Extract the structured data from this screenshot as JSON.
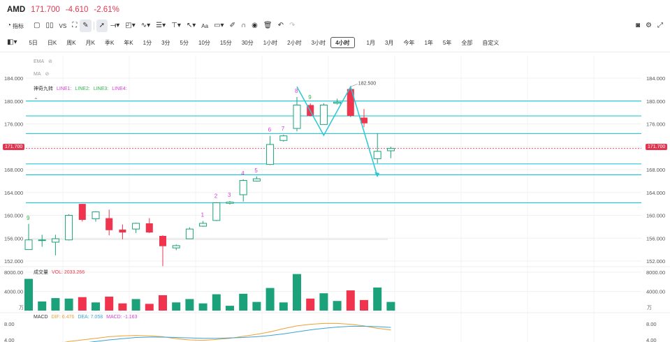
{
  "header": {
    "symbol": "AMD",
    "price": "171.700",
    "change": "-4.610",
    "change_pct": "-2.61%",
    "neg_color": "#e0364f"
  },
  "toolbar": {
    "indicators_label": "指标",
    "vs_label": "VS",
    "text_tool_label": "Aa",
    "icons": [
      "indicators-icon",
      "square-icon",
      "pair-icon",
      "vs-icon",
      "compare-icon",
      "brush-icon",
      "cursor-icon",
      "line-tool-icon",
      "rect-tool-icon",
      "wave-tool-icon",
      "fib-tool-icon",
      "measure-tool-icon",
      "arrow-tool-icon",
      "text-tool-icon",
      "comment-icon",
      "pen-icon",
      "magnet-icon",
      "eye-icon",
      "trash-icon",
      "undo-icon",
      "redo-icon",
      "camera-icon",
      "settings-icon",
      "fullscreen-icon"
    ]
  },
  "periods": {
    "layout_icon": "layout-icon",
    "items": [
      "5日",
      "日K",
      "周K",
      "月K",
      "季K",
      "年K",
      "1分",
      "3分",
      "5分",
      "10分",
      "15分",
      "30分",
      "1小时",
      "2小时",
      "3小时",
      "4小时",
      "1月",
      "3月",
      "今年",
      "1年",
      "5年",
      "全部",
      "自定义"
    ],
    "active": "4小时"
  },
  "main_chart": {
    "ema_label": "EMA",
    "ma_label": "MA",
    "td_label": "神奇九转",
    "lines": [
      {
        "name": "LINE1:",
        "color": "#d63cd6"
      },
      {
        "name": "LINE2:",
        "color": "#2fb54a"
      },
      {
        "name": "LINE3:",
        "color": "#2fb54a"
      },
      {
        "name": "LINE4:",
        "color": "#d63cd6"
      }
    ],
    "current_price_tag": "171.700",
    "peak_label": "182.500",
    "up_color": "#1ba27a",
    "down_color": "#f0344d",
    "support_color": "#29c7d6"
  },
  "volume": {
    "title": "成交量",
    "vol_label": "VOL: 2033.266",
    "unit": "万"
  },
  "macd": {
    "title": "MACD",
    "dif": "DIF: 6.476",
    "dea": "DEA: 7.058",
    "macd": "MACD: -1.163",
    "dif_color": "#f0a030",
    "dea_color": "#3aa3d9",
    "macd_color": "#d63cd6"
  },
  "chart_data": {
    "type": "candlestick",
    "price_axis_ticks": [
      "184.000",
      "180.000",
      "176.000",
      "172.000",
      "168.000",
      "164.000",
      "160.000",
      "156.000",
      "152.000"
    ],
    "volume_axis_ticks": [
      "8000.00",
      "4000.00"
    ],
    "macd_axis_ticks": [
      "8.00",
      "4.00"
    ],
    "support_lines": [
      180.0,
      177.4,
      174.3,
      169.0,
      167.1,
      162.2
    ],
    "candles": [
      {
        "o": 154.0,
        "c": 155.7,
        "h": 158.5,
        "l": 154.0,
        "td": "9",
        "td_color": "#2fb54a"
      },
      {
        "o": 155.6,
        "c": 155.7,
        "h": 156.6,
        "l": 154.5
      },
      {
        "o": 155.3,
        "c": 155.9,
        "h": 156.6,
        "l": 153.0
      },
      {
        "o": 155.7,
        "c": 160.0,
        "h": 160.2,
        "l": 155.6
      },
      {
        "o": 162.0,
        "c": 159.2,
        "h": 162.0,
        "l": 158.9
      },
      {
        "o": 159.4,
        "c": 160.6,
        "h": 160.7,
        "l": 158.9
      },
      {
        "o": 159.5,
        "c": 157.4,
        "h": 161.0,
        "l": 156.5
      },
      {
        "o": 157.5,
        "c": 157.0,
        "h": 158.4,
        "l": 155.8
      },
      {
        "o": 157.6,
        "c": 158.6,
        "h": 158.7,
        "l": 156.9
      },
      {
        "o": 158.6,
        "c": 157.0,
        "h": 159.5,
        "l": 156.9
      },
      {
        "o": 156.4,
        "c": 154.6,
        "h": 156.5,
        "l": 151.1
      },
      {
        "o": 154.3,
        "c": 154.7,
        "h": 154.9,
        "l": 153.9
      },
      {
        "o": 155.9,
        "c": 157.6,
        "h": 157.9,
        "l": 155.9
      },
      {
        "o": 158.1,
        "c": 158.6,
        "h": 159.0,
        "l": 158.0,
        "td": "1",
        "td_color": "#d63cd6"
      },
      {
        "o": 159.1,
        "c": 162.2,
        "h": 162.3,
        "l": 159.0,
        "td": "2",
        "td_color": "#d63cd6"
      },
      {
        "o": 162.1,
        "c": 162.3,
        "h": 162.5,
        "l": 161.9,
        "td": "3",
        "td_color": "#d63cd6"
      },
      {
        "o": 163.6,
        "c": 166.1,
        "h": 166.3,
        "l": 162.4,
        "td": "4",
        "td_color": "#d63cd6"
      },
      {
        "o": 166.0,
        "c": 166.4,
        "h": 166.8,
        "l": 165.9,
        "td": "5",
        "td_color": "#d63cd6"
      },
      {
        "o": 168.9,
        "c": 172.4,
        "h": 173.9,
        "l": 168.8,
        "td": "6",
        "td_color": "#d63cd6"
      },
      {
        "o": 173.1,
        "c": 173.9,
        "h": 174.1,
        "l": 172.9,
        "td": "7",
        "td_color": "#d63cd6"
      },
      {
        "o": 175.2,
        "c": 179.3,
        "h": 180.7,
        "l": 174.7,
        "td": "8",
        "td_color": "#d63cd6"
      },
      {
        "o": 179.3,
        "c": 177.4,
        "h": 179.6,
        "l": 177.3,
        "td": "9",
        "td_color": "#2fb54a"
      },
      {
        "o": 175.9,
        "c": 179.3,
        "h": 179.6,
        "l": 175.9
      },
      {
        "o": 179.6,
        "c": 179.8,
        "h": 180.4,
        "l": 179.4
      },
      {
        "o": 182.1,
        "c": 177.4,
        "h": 182.5,
        "l": 177.2
      },
      {
        "o": 177.1,
        "c": 176.1,
        "h": 178.6,
        "l": 175.4
      },
      {
        "o": 169.9,
        "c": 171.2,
        "h": 174.4,
        "l": 169.1
      },
      {
        "o": 171.3,
        "c": 171.7,
        "h": 172.0,
        "l": 170.0
      }
    ],
    "volume": [
      6600,
      1900,
      2600,
      2500,
      2800,
      1700,
      2900,
      1500,
      2400,
      1400,
      3200,
      1700,
      2400,
      1500,
      3400,
      1000,
      3500,
      1800,
      4700,
      1700,
      7600,
      2500,
      3600,
      2000,
      4200,
      2200,
      4800,
      1800
    ],
    "zigzag_points": [
      [
        20,
        182.5
      ],
      [
        22,
        174.0
      ],
      [
        24,
        182.5
      ],
      [
        26,
        166.8
      ]
    ],
    "dif": [
      2.2,
      2.6,
      3.0,
      3.6,
      4.0,
      4.4,
      4.8,
      5.0,
      5.1,
      5.0,
      4.8,
      4.3,
      4.0,
      3.9,
      4.1,
      4.4,
      4.9,
      5.4,
      6.0,
      6.8,
      7.5,
      7.9,
      8.1,
      8.1,
      7.9,
      7.5,
      6.9,
      6.5
    ],
    "dea": [
      1.8,
      2.0,
      2.4,
      2.8,
      3.2,
      3.6,
      4.0,
      4.3,
      4.6,
      4.7,
      4.7,
      4.6,
      4.5,
      4.4,
      4.4,
      4.5,
      4.6,
      4.8,
      5.1,
      5.5,
      6.0,
      6.5,
      6.9,
      7.2,
      7.4,
      7.4,
      7.3,
      7.1
    ]
  }
}
